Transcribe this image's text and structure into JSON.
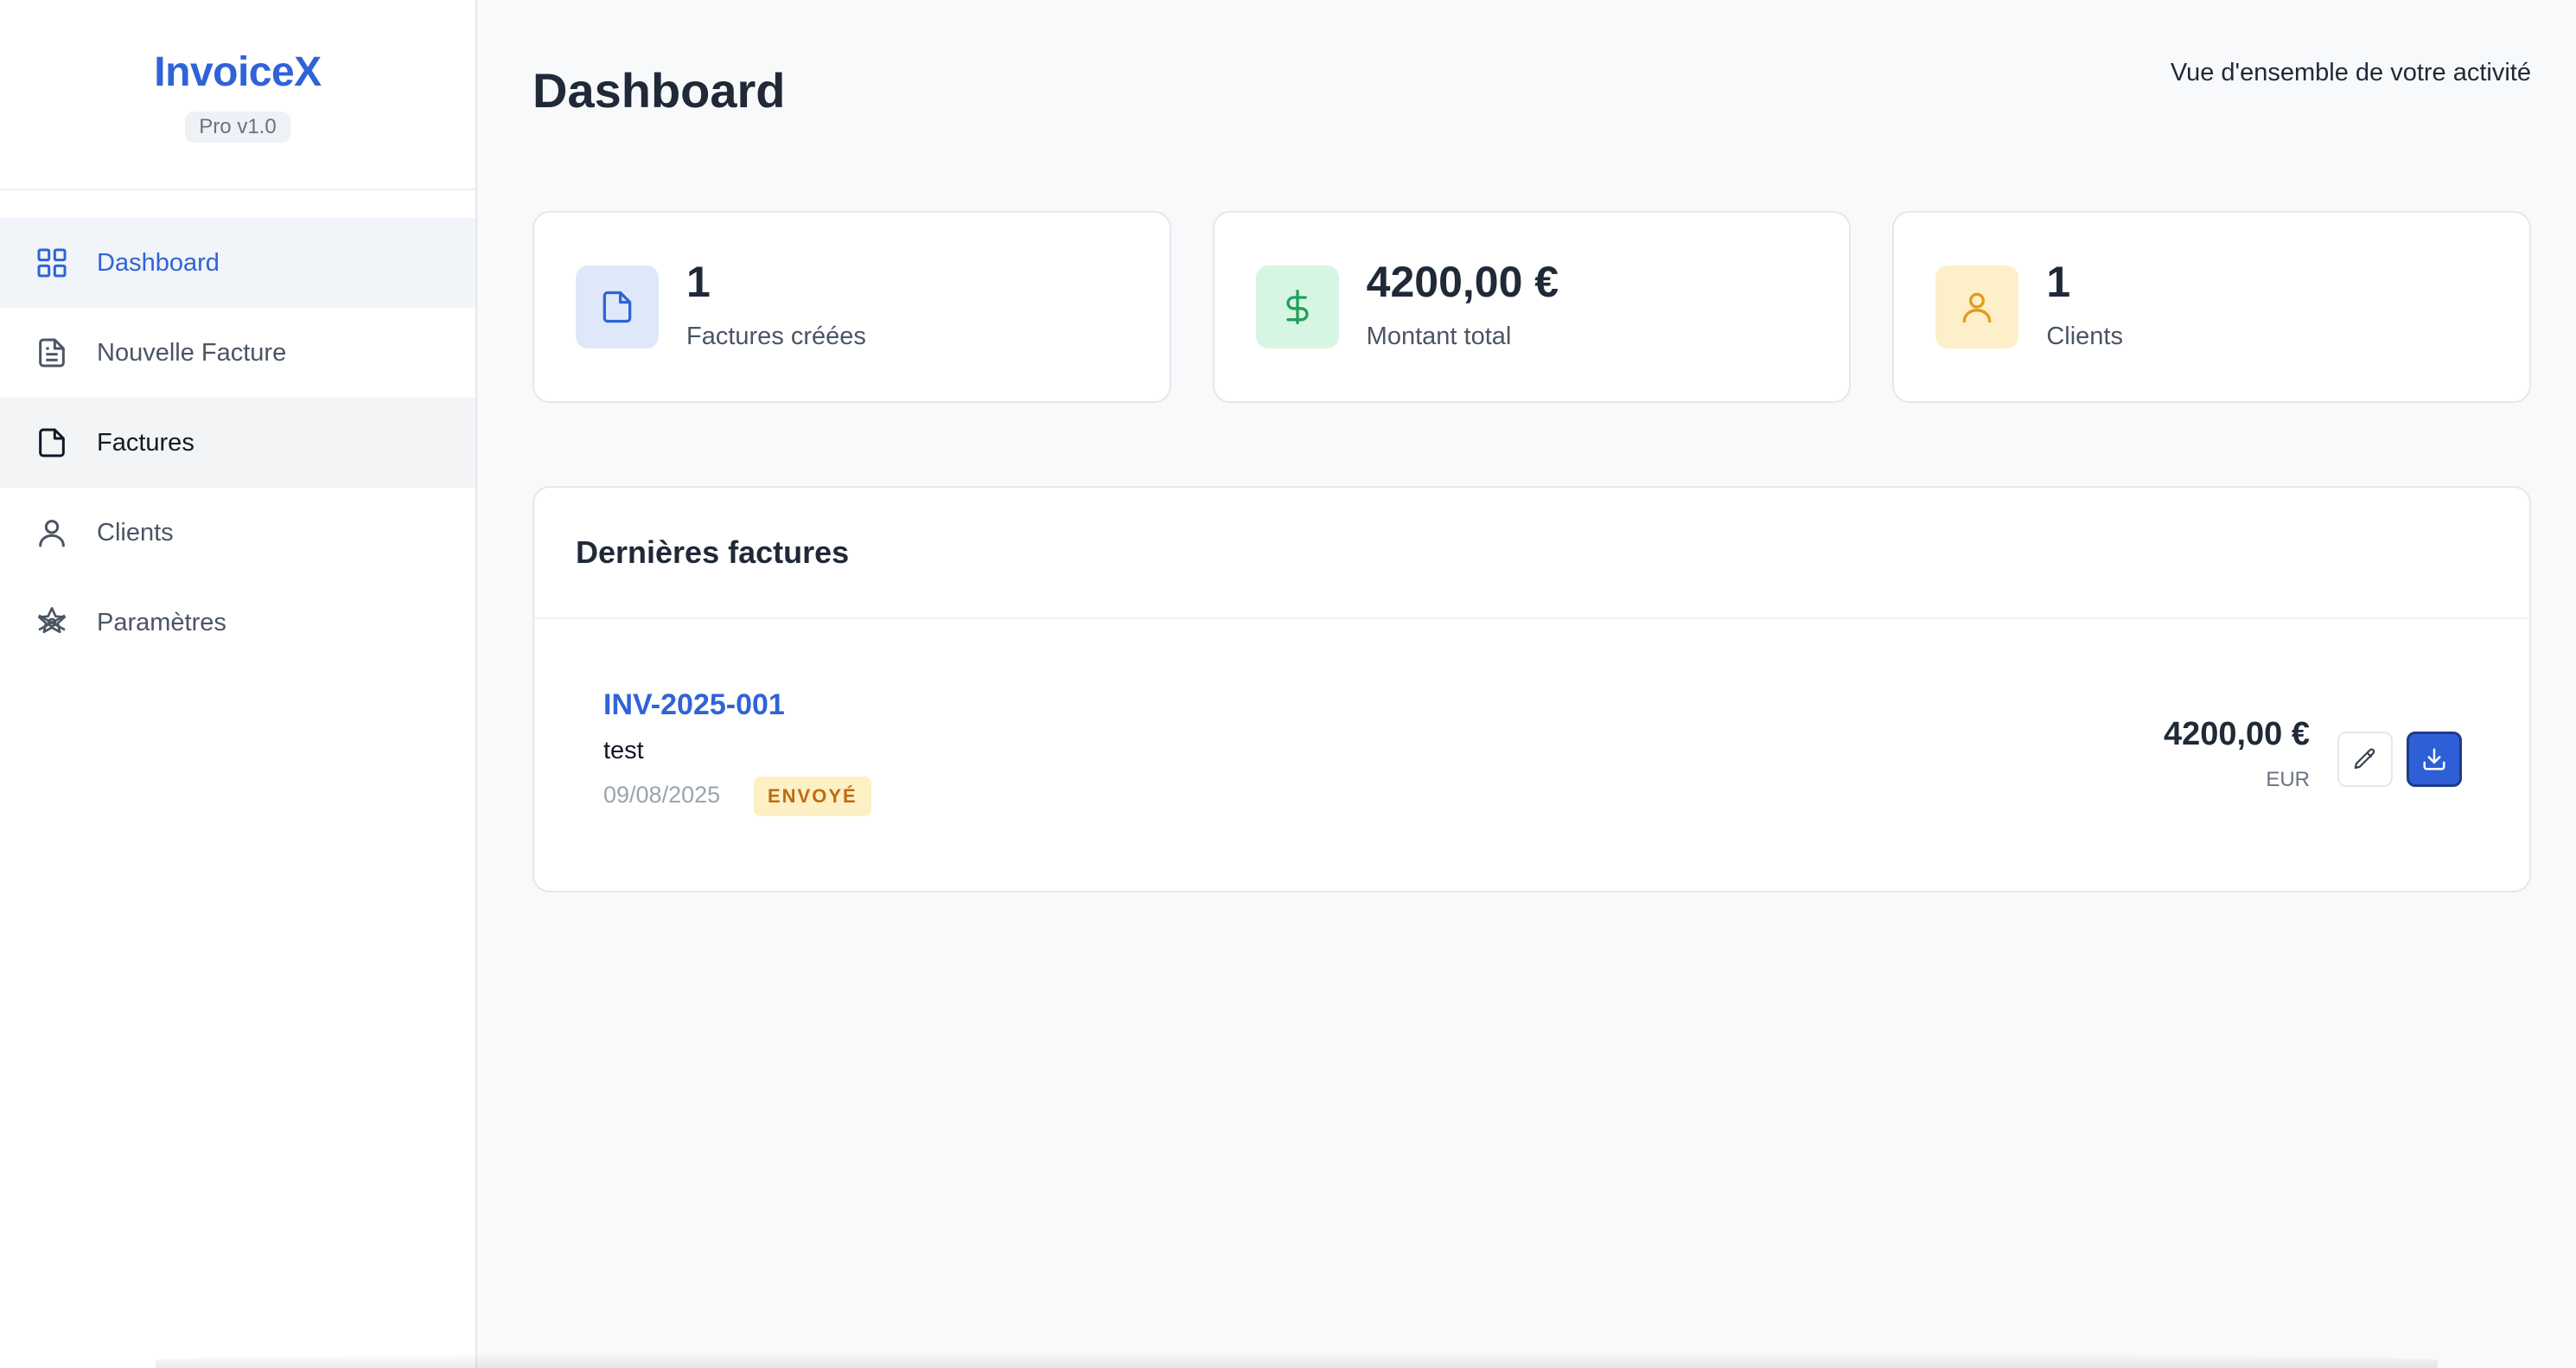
{
  "brand": {
    "name": "InvoiceX",
    "version": "Pro v1.0"
  },
  "sidebar": {
    "items": [
      {
        "label": "Dashboard",
        "icon": "grid-icon",
        "active": true
      },
      {
        "label": "Nouvelle Facture",
        "icon": "document-lines-icon"
      },
      {
        "label": "Factures",
        "icon": "document-icon",
        "hovered": true
      },
      {
        "label": "Clients",
        "icon": "user-icon"
      },
      {
        "label": "Paramètres",
        "icon": "settings-star-icon"
      }
    ]
  },
  "header": {
    "title": "Dashboard",
    "subtitle": "Vue d'ensemble de votre activité"
  },
  "stats": [
    {
      "value": "1",
      "label": "Factures créées",
      "icon": "document-icon",
      "color": "#2f63d8",
      "bg": "#dfe8fb"
    },
    {
      "value": "4200,00 €",
      "label": "Montant total",
      "icon": "dollar-icon",
      "color": "#22a05a",
      "bg": "#d7f5e3"
    },
    {
      "value": "1",
      "label": "Clients",
      "icon": "user-icon",
      "color": "#e39a1c",
      "bg": "#fdefc7"
    }
  ],
  "recent_invoices": {
    "title": "Dernières factures",
    "rows": [
      {
        "number": "INV-2025-001",
        "client": "test",
        "date": "09/08/2025",
        "status": "ENVOYÉ",
        "amount": "4200,00 €",
        "currency": "EUR"
      }
    ]
  },
  "colors": {
    "accent": "#2f63d8",
    "status_sent_bg": "#fdf0c4",
    "status_sent_text": "#c26a0f"
  }
}
